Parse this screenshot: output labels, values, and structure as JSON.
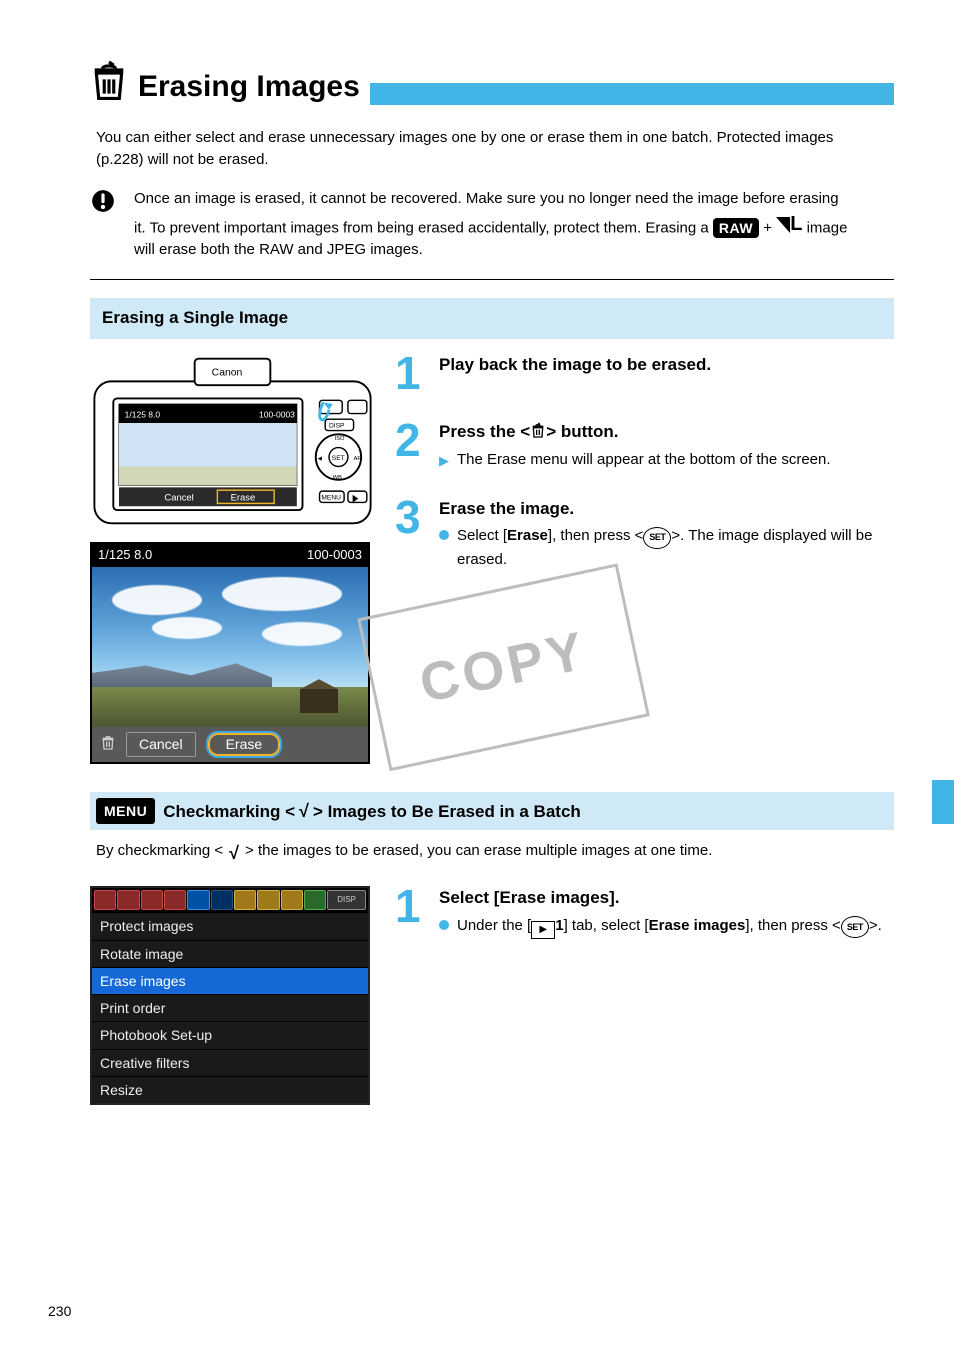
{
  "header": {
    "title": "Erasing Images"
  },
  "intro": "You can either select and erase unnecessary images one by one or erase them in one batch. Protected images (p.228) will not be erased.",
  "caution": "Once an image is erased, it cannot be recovered. Make sure you no longer need the image before erasing it. To prevent important images from being erased accidentally, protect them. Erasing a ",
  "caution_tail": " image will erase both the RAW and JPEG images.",
  "raw_label": "RAW",
  "plus": "+",
  "large_l": "L",
  "section1": {
    "heading": "Erasing a Single Image",
    "step1": "Play back the image to be erased.",
    "step2_title_a": "Press the <",
    "step2_title_b": "> button.",
    "step2_line": "The Erase menu will appear at the bottom of the screen.",
    "step3_title": "Erase the image.",
    "step3_line_a": "Select [",
    "step3_erase": "Erase",
    "step3_line_b": "], then press <",
    "step3_line_c": ">. The image displayed will be erased.",
    "ss_top_left": "1/125    8.0",
    "ss_top_right": "100-0003",
    "ss_cancel": "Cancel",
    "ss_erase": "Erase"
  },
  "section2": {
    "band_a": " Checkmarking <",
    "band_b": "> Images to Be Erased in a Batch",
    "sub_a": "By checkmarking <",
    "sub_b": "> the images to be erased, you can erase multiple images at one time.",
    "step1_title_a": "Select [Erase images].",
    "step1_line_a": "Under the [",
    "play_num": "1",
    "step1_line_b": "] tab, select [",
    "step1_erase_images": "Erase images",
    "step1_line_c": "], then press <",
    "step1_line_d": ">."
  },
  "menu": {
    "items": [
      "Protect images",
      "Rotate image",
      "Erase images",
      "Print order",
      "Photobook Set-up",
      "Creative filters",
      "Resize"
    ],
    "disp": "DISP"
  },
  "set_label": "SET",
  "menu_badge": "MENU",
  "copy_stamp": "COPY",
  "page_number": "230"
}
